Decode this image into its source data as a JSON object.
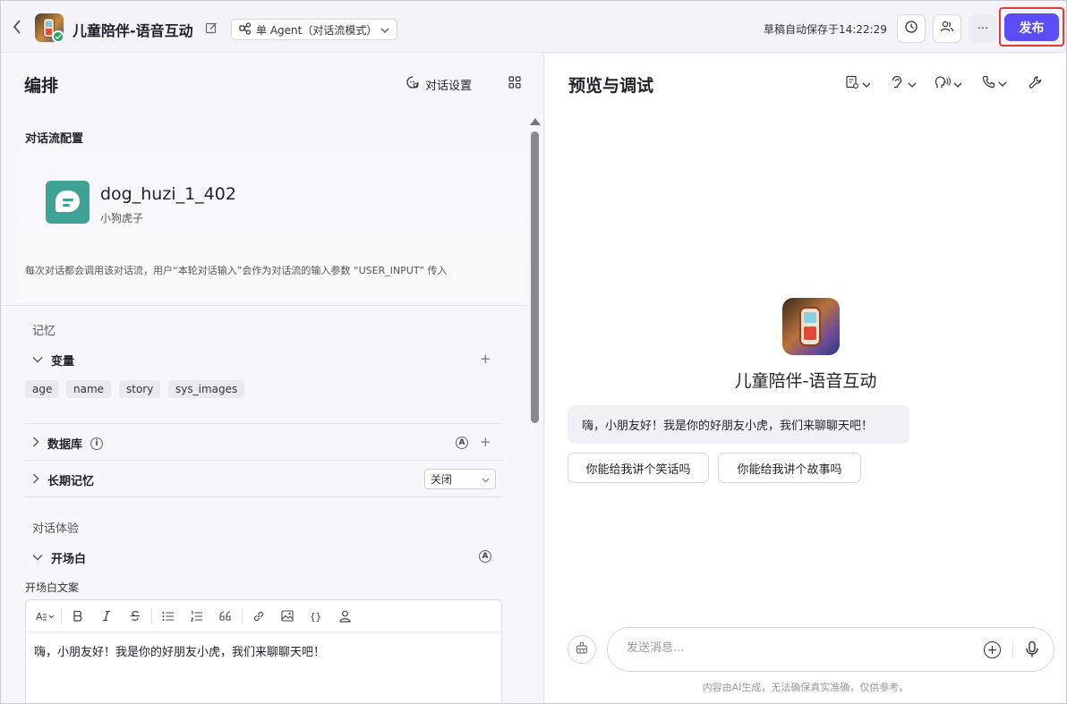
{
  "header": {
    "title": "儿童陪伴-语音互动",
    "mode": "单 Agent（对话流模式）",
    "saved_status": "草稿自动保存于14:22:29",
    "more_label": "···",
    "publish_label": "发布"
  },
  "left": {
    "title": "编排",
    "conv_settings_label": "对话设置",
    "flow_section_title": "对话流配置",
    "flow": {
      "name": "dog_huzi_1_402",
      "subtitle": "小狗虎子",
      "description": "每次对话都会调用该对话流，用户“本轮对话输入”会作为对话流的输入参数 “USER_INPUT” 传入"
    },
    "memory_label": "记忆",
    "variables_label": "变量",
    "variables": [
      "age",
      "name",
      "story",
      "sys_images"
    ],
    "database_label": "数据库",
    "longterm_label": "长期记忆",
    "longterm_value": "关闭",
    "experience_label": "对话体验",
    "opening_label": "开场白",
    "opening_caption": "开场白文案",
    "opening_text": "嗨，小朋友好！我是你的好朋友小虎，我们来聊聊天吧！",
    "auto_symbol": "A",
    "plus_symbol": "+"
  },
  "right": {
    "title": "预览与调试",
    "bot_name": "儿童陪伴-语音互动",
    "greeting": "嗨，小朋友好！我是你的好朋友小虎，我们来聊聊天吧！",
    "suggestions": [
      "你能给我讲个笑话吗",
      "你能给我讲个故事吗"
    ],
    "input_placeholder": "发送消息...",
    "disclaimer": "内容由AI生成，无法确保真实准确，仅供参考。"
  }
}
